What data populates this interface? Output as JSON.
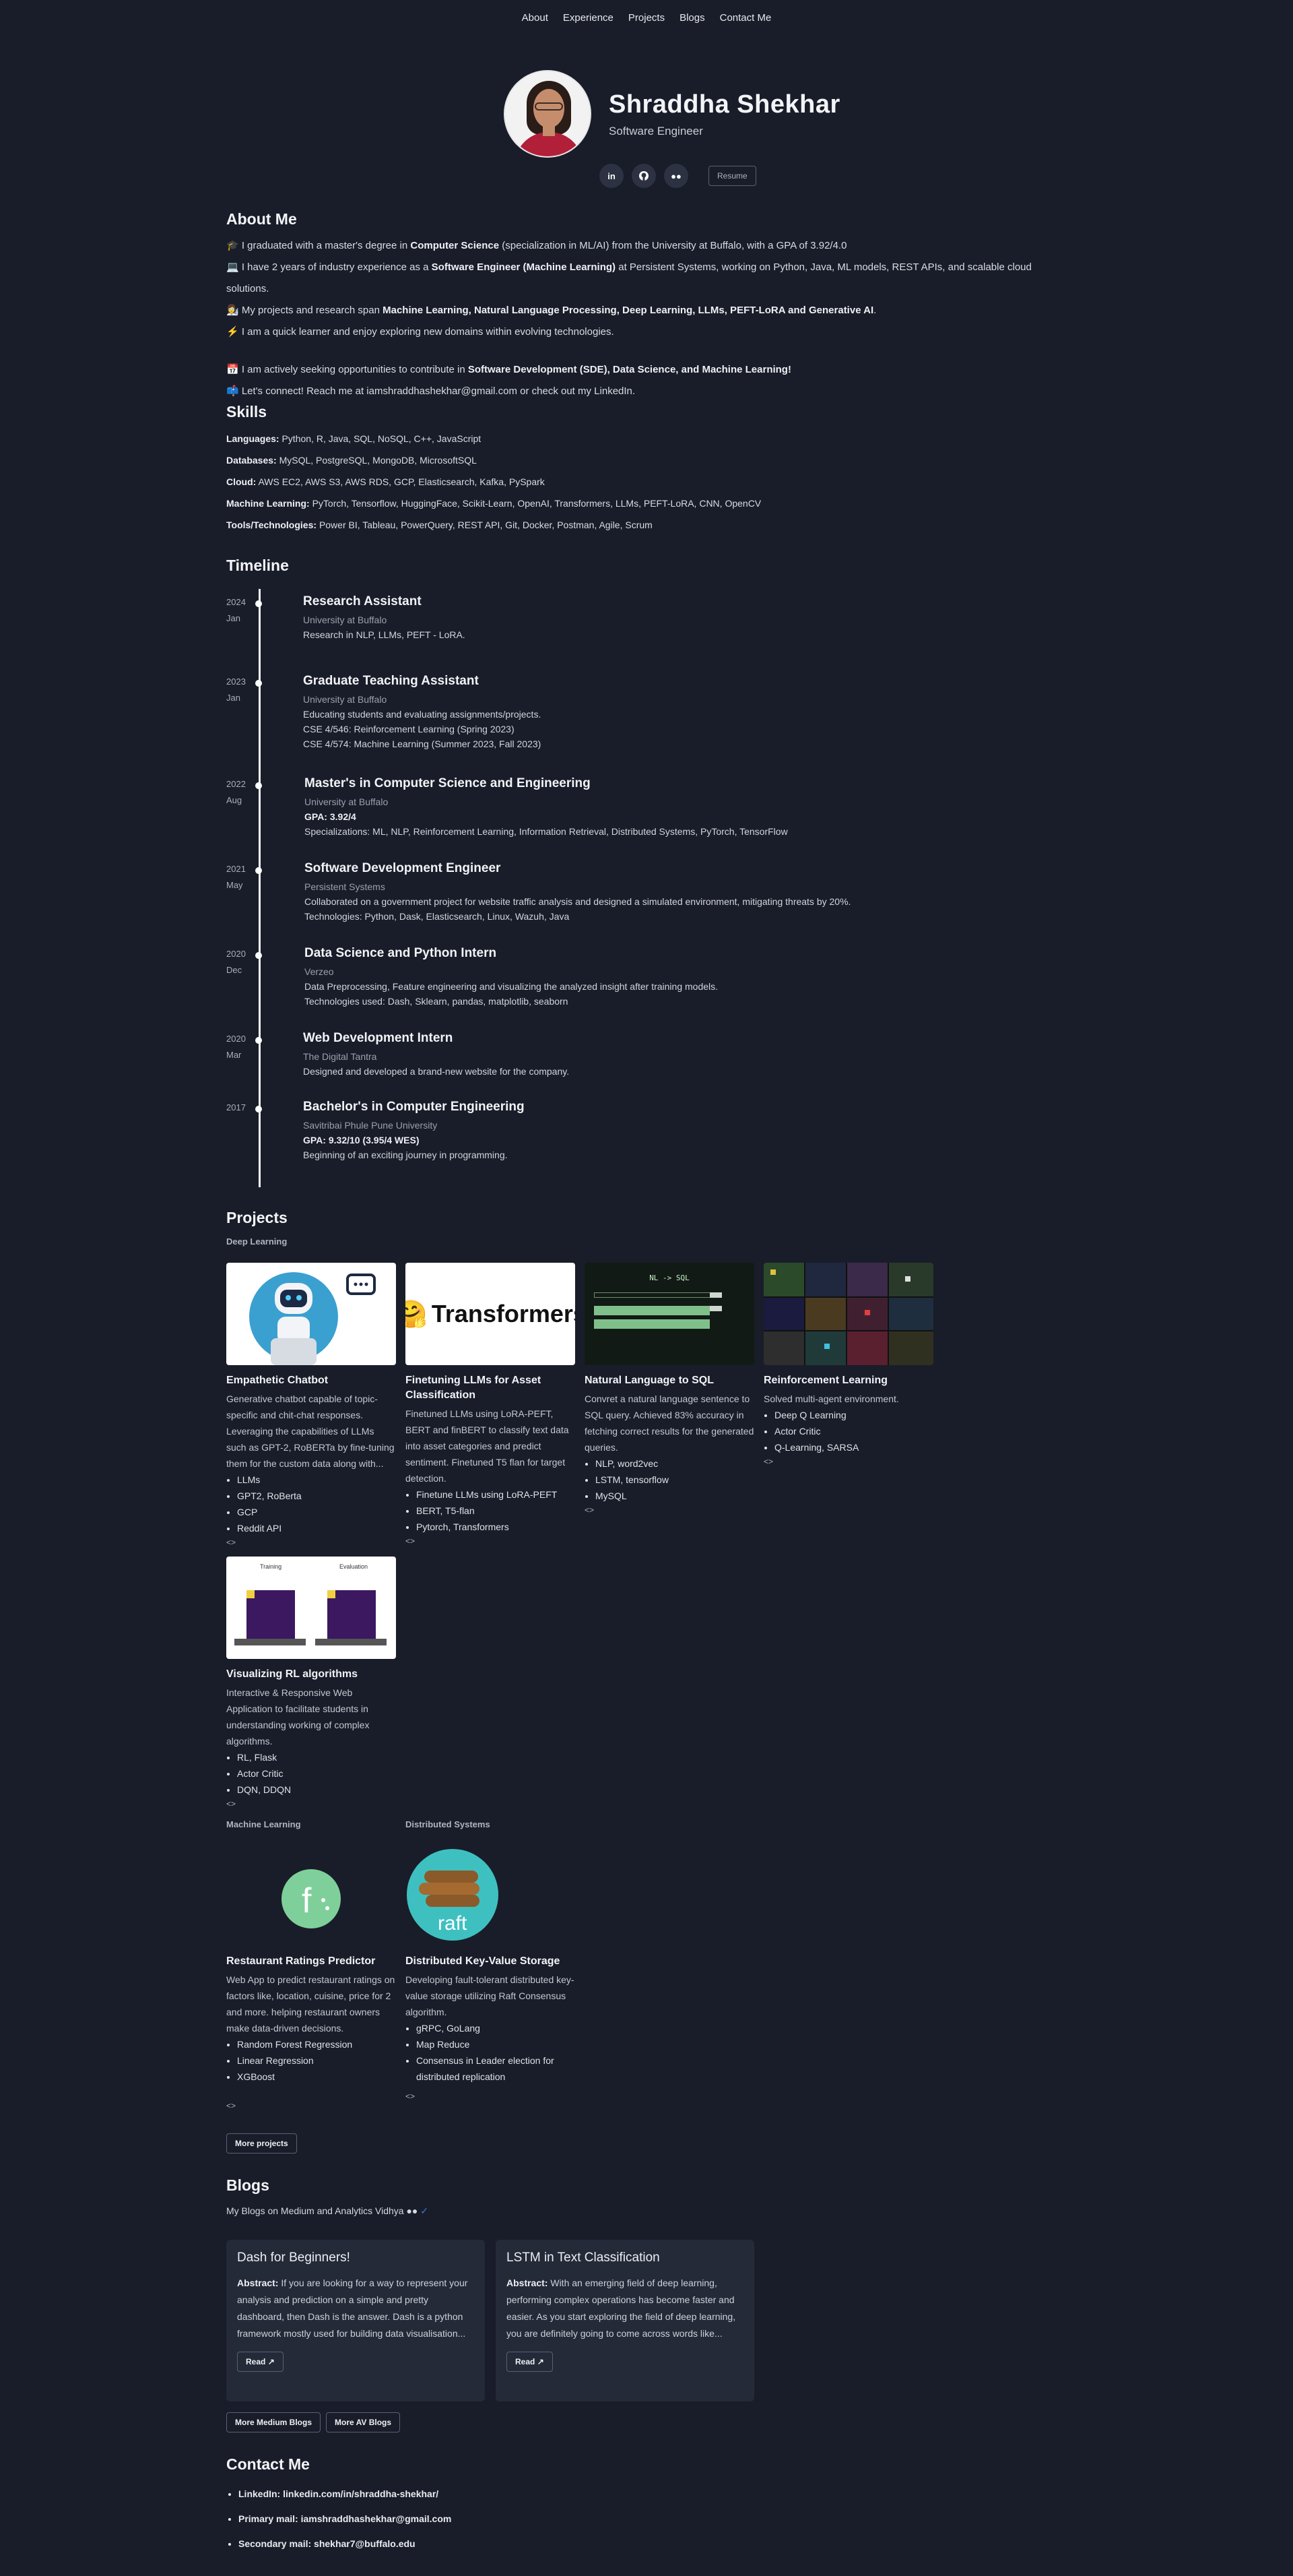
{
  "nav": [
    "About",
    "Experience",
    "Projects",
    "Blogs",
    "Contact Me"
  ],
  "hero": {
    "name": "Shraddha Shekhar",
    "role": "Software Engineer",
    "resume": "Resume",
    "icons": [
      "linkedin-icon",
      "github-icon",
      "medium-icon"
    ]
  },
  "about": {
    "title": "About Me",
    "lines": [
      [
        "🎓 I graduated with a master's degree in ",
        "Computer Science",
        " (specialization in ML/AI) from the University at Buffalo, with a GPA of 3.92/4.0"
      ],
      [
        "💻 I have 2 years of industry experience as a ",
        "Software Engineer (Machine Learning)",
        " at Persistent Systems, working on Python, Java, ML models, REST APIs, and scalable cloud solutions."
      ],
      [
        "👩‍🔬 My projects and research span ",
        "Machine Learning, Natural Language Processing, Deep Learning, LLMs, PEFT-LoRA and Generative AI",
        ""
      ],
      [
        "⚡ I am a quick learner and enjoy exploring new domains within evolving technologies.",
        "",
        ""
      ],
      [
        "📅 I am actively seeking opportunities to contribute in ",
        "Software Development (SDE), Data Science, and Machine Learning!",
        ""
      ],
      [
        "📫 Let's connect! Reach me at iamshraddhashekhar@gmail.com or check out my LinkedIn.",
        "",
        ""
      ]
    ]
  },
  "skills": {
    "title": "Skills",
    "rows": [
      {
        "k": "Languages:",
        "v": "Python, R, Java, SQL, NoSQL, C++, JavaScript"
      },
      {
        "k": "Databases:",
        "v": "MySQL, PostgreSQL, MongoDB, MicrosoftSQL"
      },
      {
        "k": "Cloud:",
        "v": "AWS EC2, AWS S3, AWS RDS, GCP, Elasticsearch, Kafka, PySpark"
      },
      {
        "k": "Machine Learning:",
        "v": "PyTorch, Tensorflow, HuggingFace, Scikit-Learn, OpenAI, Transformers, LLMs, PEFT-LoRA, CNN, OpenCV"
      },
      {
        "k": "Tools/Technologies:",
        "v": "Power BI, Tableau, PowerQuery, REST API, Git, Docker, Postman, Agile, Scrum"
      }
    ]
  },
  "timeline": {
    "title": "Timeline",
    "items": [
      {
        "year": "2024",
        "month": "Jan",
        "title": "Research Assistant",
        "org": "University at Buffalo",
        "lines": [
          "Research in NLP, LLMs, PEFT - LoRA."
        ]
      },
      {
        "year": "2023",
        "month": "Jan",
        "title": "Graduate Teaching Assistant",
        "org": "University at Buffalo",
        "lines": [
          "Educating students and evaluating assignments/projects.",
          "CSE 4/546: Reinforcement Learning (Spring 2023)",
          "CSE 4/574: Machine Learning (Summer 2023, Fall 2023)"
        ]
      },
      {
        "year": "2022",
        "month": "Aug",
        "title": "Master's in Computer Science and Engineering",
        "org": "University at Buffalo",
        "bold": "GPA: 3.92/4",
        "lines": [
          "Specializations: ML, NLP, Reinforcement Learning, Information Retrieval, Distributed Systems, PyTorch, TensorFlow"
        ]
      },
      {
        "year": "2021",
        "month": "May",
        "title": "Software Development Engineer",
        "org": "Persistent Systems",
        "lines": [
          "Collaborated on a government project for website traffic analysis and designed a simulated environment, mitigating threats by 20%.",
          "Technologies: Python, Dask, Elasticsearch, Linux, Wazuh, Java"
        ]
      },
      {
        "year": "2020",
        "month": "Dec",
        "title": "Data Science and Python Intern",
        "org": "Verzeo",
        "lines": [
          "Data Preprocessing, Feature engineering and visualizing the analyzed insight after training models.",
          "Technologies used: Dash, Sklearn, pandas, matplotlib, seaborn"
        ]
      },
      {
        "year": "2020",
        "month": "Mar",
        "title": "Web Development Intern",
        "org": "The Digital Tantra",
        "lines": [
          "Designed and developed a brand-new website for the company."
        ]
      },
      {
        "year": "2017",
        "month": "",
        "title": "Bachelor's in Computer Engineering",
        "org": "Savitribai Phule Pune University",
        "bold": "GPA: 9.32/10 (3.95/4 WES)",
        "lines": [
          "Beginning of an exciting journey in programming."
        ]
      }
    ]
  },
  "projects": {
    "title": "Projects",
    "deep_label": "Deep Learning",
    "ml_label": "Machine Learning",
    "ds_label": "Distributed Systems",
    "more": "More projects",
    "code": "<>",
    "cards": [
      {
        "title": "Empathetic Chatbot",
        "desc": "Generative chatbot capable of topic-specific and chit-chat responses. Leveraging the capabilities of LLMs such as GPT-2, RoBERTa by fine-tuning them for the custom data along with...",
        "tags": [
          "LLMs",
          "GPT2, RoBerta",
          "GCP",
          "Reddit API"
        ]
      },
      {
        "title": "Finetuning LLMs for Asset Classification",
        "desc": "Finetuned LLMs using LoRA-PEFT, BERT and finBERT to classify text data into asset categories and predict sentiment. Finetuned T5 flan for target detection.",
        "tags": [
          "Finetune LLMs using LoRA-PEFT",
          "BERT, T5-flan",
          "Pytorch, Transformers"
        ],
        "thumb_text": "Transformers"
      },
      {
        "title": "Natural Language to SQL",
        "desc": "Convret a natural language sentence to SQL query. Achieved 83% accuracy in fetching correct results for the generated queries.",
        "tags": [
          "NLP, word2vec",
          "LSTM, tensorflow",
          "MySQL"
        ],
        "thumb_text": "NL -> SQL"
      },
      {
        "title": "Reinforcement Learning",
        "desc": "Solved multi-agent environment.",
        "tags": [
          "Deep Q Learning",
          "Actor Critic",
          "Q-Learning, SARSA"
        ]
      },
      {
        "title": "Visualizing RL algorithms",
        "desc": "Interactive & Responsive Web Application to facilitate students in understanding working of complex algorithms.",
        "tags": [
          "RL, Flask",
          "Actor Critic",
          "DQN, DDQN"
        ],
        "thumb_labels": [
          "Training",
          "Evaluation"
        ]
      },
      {
        "title": "Restaurant Ratings Predictor",
        "desc": "Web App to predict restaurant ratings on factors like, location, cuisine, price for 2 and more. helping restaurant owners make data-driven decisions.",
        "tags": [
          "Random Forest Regression",
          "Linear Regression",
          "XGBoost"
        ]
      },
      {
        "title": "Distributed Key-Value Storage",
        "desc": "Developing fault-tolerant distributed key-value storage utilizing Raft Consensus algorithm.",
        "tags": [
          "gRPC, GoLang",
          "Map Reduce",
          "Consensus in Leader election for distributed replication"
        ],
        "thumb_text": "raft"
      }
    ]
  },
  "blogs": {
    "title": "Blogs",
    "sub": "My Blogs on Medium and Analytics Vidhya",
    "items": [
      {
        "title": "Dash for Beginners!",
        "abs_label": "Abstract:",
        "abs": " If you are looking for a way to represent your analysis and prediction on a simple and pretty dashboard, then Dash is the answer. Dash is a python framework mostly used for building data visualisation...",
        "read": "Read"
      },
      {
        "title": "LSTM in Text Classification",
        "abs_label": "Abstract:",
        "abs": " With an emerging field of deep learning, performing complex operations has become faster and easier. As you start exploring the field of deep learning, you are definitely going to come across words like...",
        "read": "Read"
      }
    ],
    "more_medium": "More Medium Blogs",
    "more_av": "More AV Blogs"
  },
  "contact": {
    "title": "Contact Me",
    "items": [
      "LinkedIn: linkedin.com/in/shraddha-shekhar/",
      "Primary mail: iamshraddhashekhar@gmail.com",
      "Secondary mail: shekhar7@buffalo.edu"
    ]
  }
}
